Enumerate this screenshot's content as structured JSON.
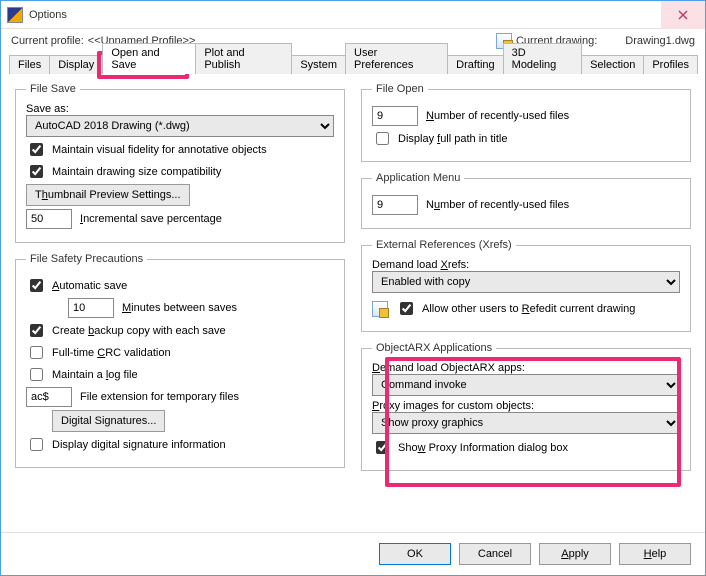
{
  "window": {
    "title": "Options"
  },
  "profile": {
    "label": "Current profile:",
    "value": "<<Unnamed Profile>>"
  },
  "drawing": {
    "label": "Current drawing:",
    "value": "Drawing1.dwg"
  },
  "tabs": [
    "Files",
    "Display",
    "Open and Save",
    "Plot and Publish",
    "System",
    "User Preferences",
    "Drafting",
    "3D Modeling",
    "Selection",
    "Profiles"
  ],
  "fileSave": {
    "legend": "File Save",
    "saveAsLabel": "Save as:",
    "saveAsValue": "AutoCAD 2018 Drawing (*.dwg)",
    "maintainVisual": "Maintain visual fidelity for annotative objects",
    "maintainSize": "Maintain drawing size compatibility",
    "thumbBtn": "Thumbnail Preview Settings...",
    "incVal": "50",
    "incLabel": "Incremental save percentage"
  },
  "safety": {
    "legend": "File Safety Precautions",
    "auto": "Automatic save",
    "minsVal": "10",
    "minsLabel": "Minutes between saves",
    "backup": "Create backup copy with each save",
    "crc": "Full-time CRC validation",
    "log": "Maintain a log file",
    "extVal": "ac$",
    "extLabel": "File extension for temporary files",
    "digBtn": "Digital Signatures...",
    "digInfo": "Display digital signature information"
  },
  "fileOpen": {
    "legend": "File Open",
    "numVal": "9",
    "numLabel": "Number of recently-used files",
    "fullPath": "Display full path in title"
  },
  "appMenu": {
    "legend": "Application Menu",
    "numVal": "9",
    "numLabel": "Number of recently-used files"
  },
  "xrefs": {
    "legend": "External References (Xrefs)",
    "demandLabel": "Demand load Xrefs:",
    "demandVal": "Enabled with copy",
    "allow": "Allow other users to Refedit current drawing"
  },
  "arx": {
    "legend": "ObjectARX Applications",
    "demandLabel": "Demand load ObjectARX apps:",
    "demandVal": "Command invoke",
    "proxyImgLabel": "Proxy images for custom objects:",
    "proxyImgVal": "Show proxy graphics",
    "showProxy": "Show Proxy Information dialog box"
  },
  "footer": {
    "ok": "OK",
    "cancel": "Cancel",
    "apply": "Apply",
    "help": "Help"
  }
}
